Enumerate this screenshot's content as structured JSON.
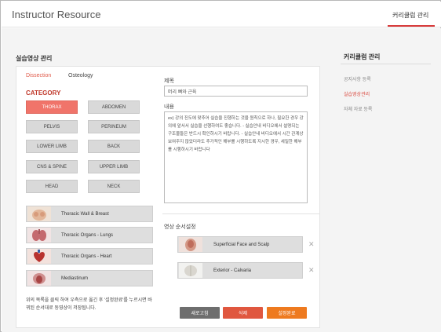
{
  "header": {
    "app_title": "Instructor Resource",
    "nav_tab": "커리큘럼 관리"
  },
  "main": {
    "section_title": "실습영상 관리",
    "tabs": [
      {
        "label": "Dissection",
        "active": true
      },
      {
        "label": "Osteology",
        "active": false
      }
    ],
    "category_title": "CATEGORY",
    "categories": [
      "THORAX",
      "ABDOMEN",
      "PELVIS",
      "PERINEUM",
      "LOWER LIMB",
      "BACK",
      "CNS & SPINE",
      "UPPER LIMB",
      "HEAD",
      "NECK"
    ],
    "active_category": "THORAX",
    "organ_items": [
      {
        "label": "Thoracic Wall & Breast",
        "icon": "thoracic-wall-thumbnail"
      },
      {
        "label": "Thoracic Organs - Lungs",
        "icon": "lungs-thumbnail"
      },
      {
        "label": "Thoracic Organs - Heart",
        "icon": "heart-thumbnail"
      },
      {
        "label": "Mediastinum",
        "icon": "mediastinum-thumbnail"
      }
    ],
    "help_text": "위의 목록을 클릭 하여 우측으로 옮긴 후 '설정완료'를 누르시면 바뀌된 순서대로 동영상이 저장됩니다."
  },
  "form": {
    "title_label": "제목",
    "title_value": "머리 뼈와 근육",
    "content_label": "내용",
    "content_value": "ex) 강의 진도에 맞추어 실습을 진행하는 것을 원칙으로 하나, 필요한 경우 강의에 앞서서 실습을 선행하여도 좋습니다. - 실습안내 비디오에서 설명되는 구조물들은 반드시 확인하시기 바랍니다. - 실습안내 비디오에서 시간 관계상 보여주지 않았더라도 추가적인 해부를 시행하도록 지시한 경우, 세밀한 해부를 시행하시기 바랍니다",
    "order_label": "영상 순서설정",
    "order_items": [
      {
        "label": "Superficial Face and Scalp",
        "icon": "face-scalp-thumbnail"
      },
      {
        "label": "Exterior - Calvaria",
        "icon": "calvaria-thumbnail"
      }
    ],
    "buttons": {
      "reset": "새로고침",
      "delete": "삭제",
      "save": "설정완료"
    }
  },
  "sidebar": {
    "title": "커리큘럼 관리",
    "links": [
      {
        "label": "공지사항 등록",
        "active": false
      },
      {
        "label": "실습영상관리",
        "active": true
      },
      {
        "label": "자체 자료 등록",
        "active": false
      }
    ]
  },
  "colors": {
    "accent": "#d83b3b",
    "category_active": "#f0746a",
    "delete_button": "#e0573f",
    "save_button": "#ee7a1f",
    "reset_button": "#6e6e6e"
  }
}
